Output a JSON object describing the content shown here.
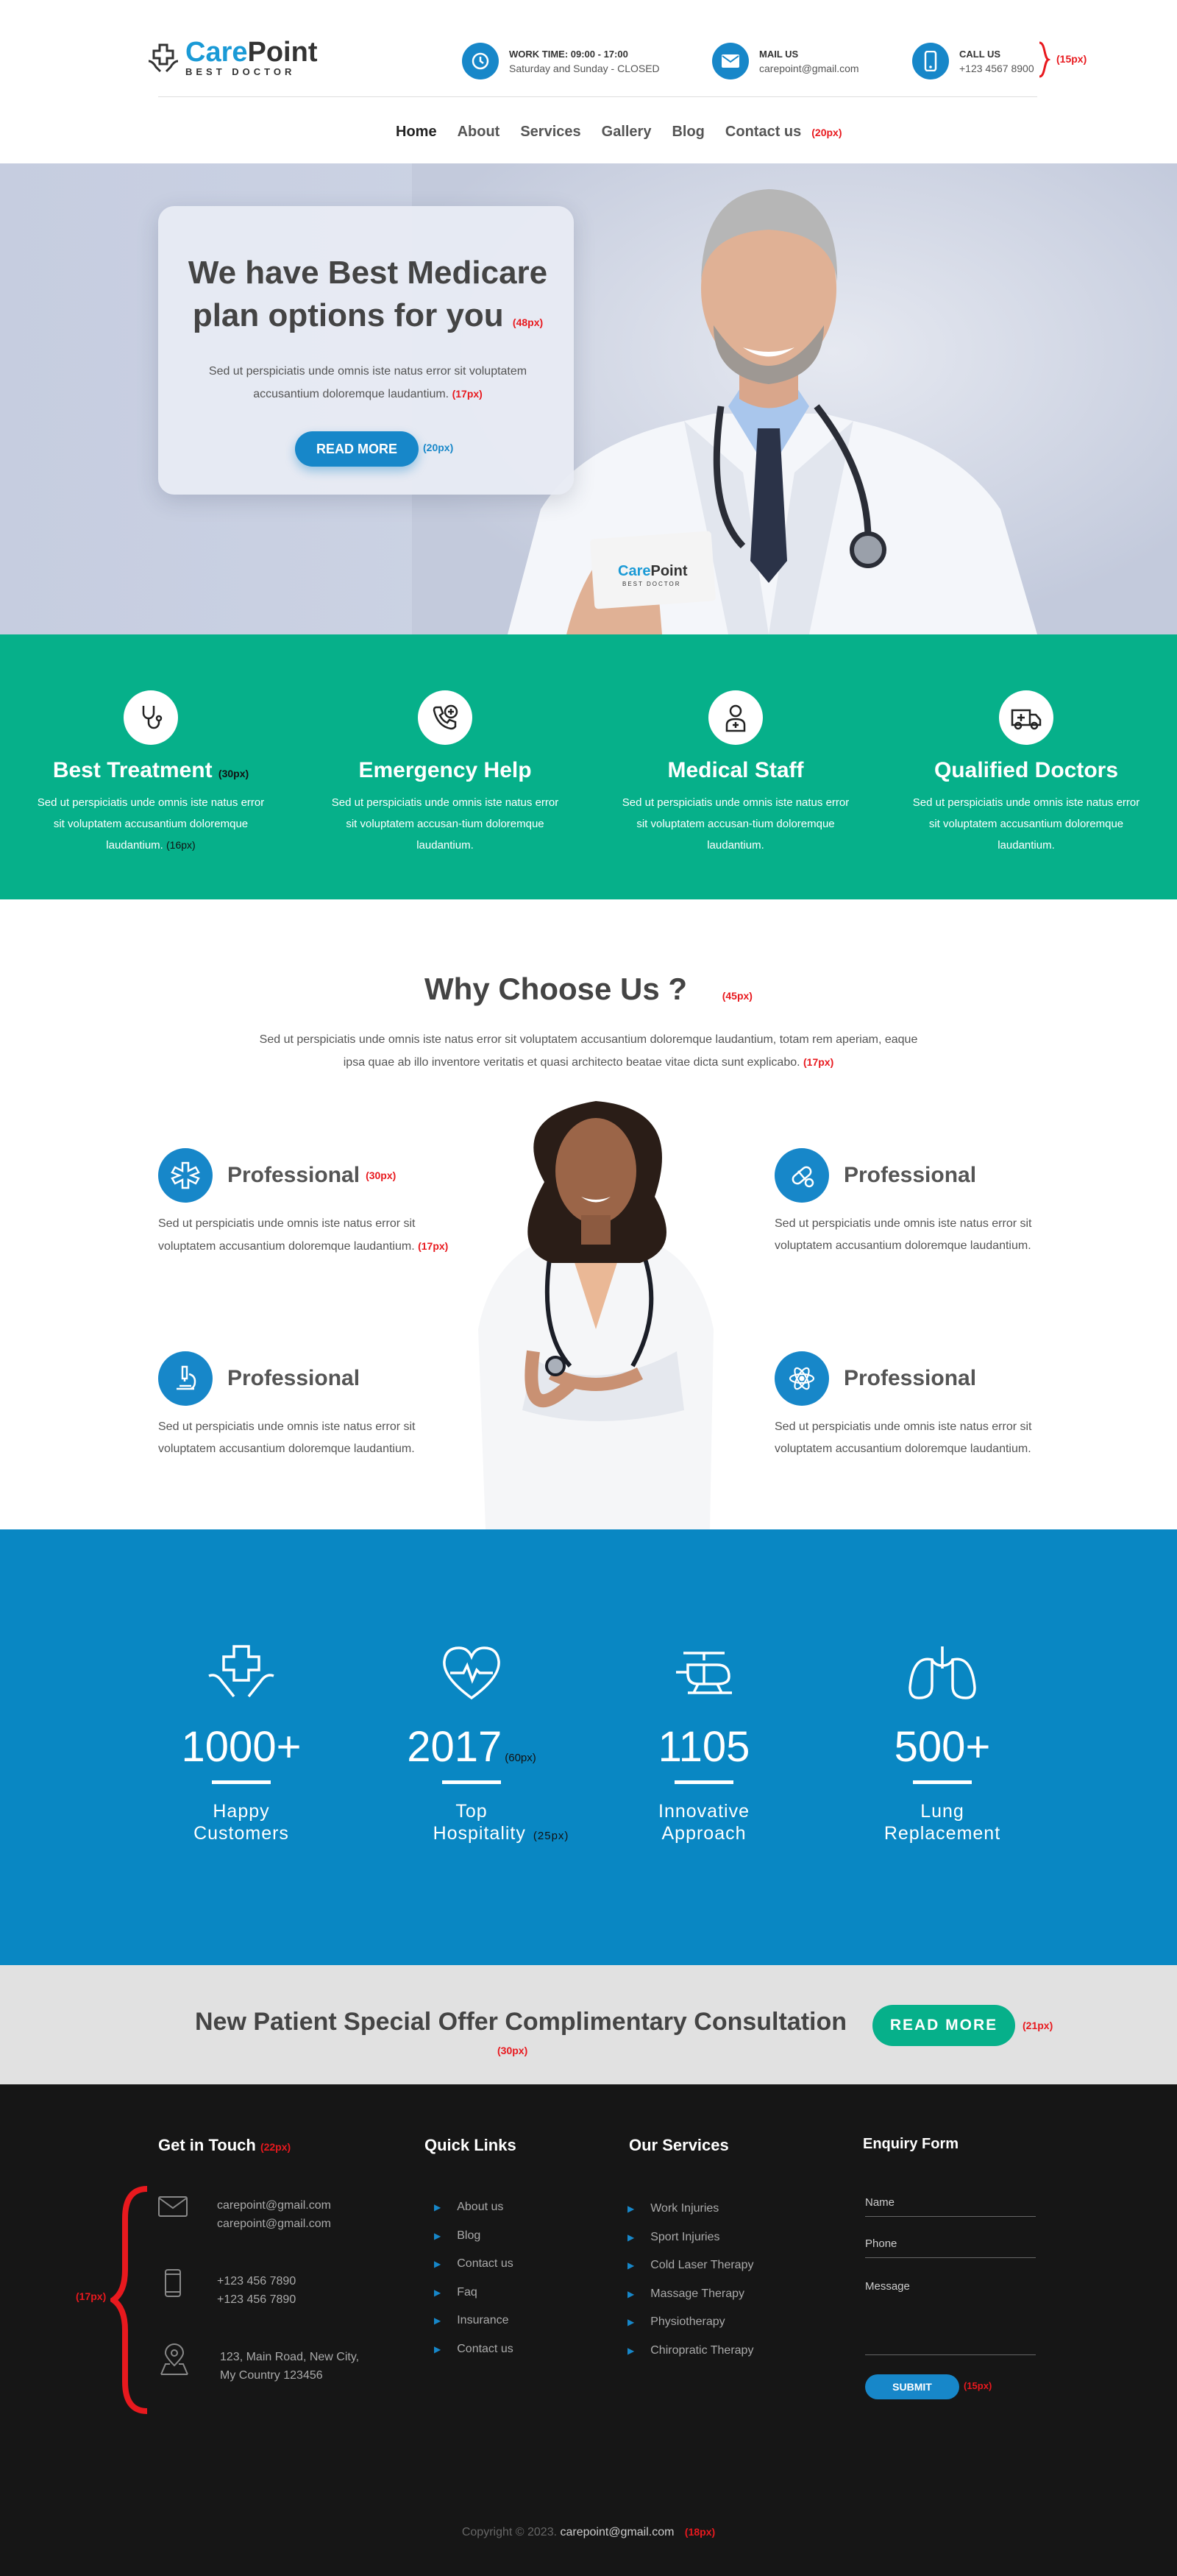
{
  "header": {
    "logo": {
      "name_part1": "Care",
      "name_part2": "Point",
      "tagline": "BEST DOCTOR"
    },
    "work": {
      "title": "WORK TIME: 09:00 - 17:00",
      "sub": "Saturday and Sunday - CLOSED",
      "icon": "clock-icon"
    },
    "mail": {
      "title": "MAIL US",
      "sub": "carepoint@gmail.com",
      "icon": "mail-icon"
    },
    "call": {
      "title": "CALL US",
      "sub": "+123 4567 8900",
      "icon": "phone-icon"
    },
    "size_note": "(15px)"
  },
  "nav": {
    "items": [
      "Home",
      "About",
      "Services",
      "Gallery",
      "Blog",
      "Contact us"
    ],
    "size_note": "(20px)"
  },
  "hero": {
    "title": "We have Best Medicare plan options for you",
    "title_note": "(48px)",
    "text": "Sed ut perspiciatis unde omnis iste natus error sit voluptatem accusantium doloremque laudantium.",
    "text_note": "(17px)",
    "button": "READ MORE",
    "button_note": "(20px)",
    "card_logo_1": "Care",
    "card_logo_2": "Point",
    "card_logo_sub": "BEST DOCTOR"
  },
  "features": {
    "title_note": "(30px)",
    "text_note": "(16px)",
    "items": [
      {
        "title": "Best Treatment",
        "text": "Sed ut perspiciatis unde omnis iste natus error sit voluptatem accusantium doloremque laudantium.",
        "icon": "stethoscope-icon"
      },
      {
        "title": "Emergency Help",
        "text": "Sed ut perspiciatis unde omnis iste natus error sit voluptatem accusan-tium doloremque laudantium.",
        "icon": "phone-medical-icon"
      },
      {
        "title": "Medical Staff",
        "text": "Sed ut perspiciatis unde omnis iste natus error sit voluptatem accusan-tium doloremque laudantium.",
        "icon": "doctor-icon"
      },
      {
        "title": "Qualified Doctors",
        "text": "Sed ut perspiciatis unde omnis iste natus error sit voluptatem accusantium doloremque laudantium.",
        "icon": "ambulance-icon"
      }
    ]
  },
  "why": {
    "title": "Why Choose Us ?",
    "title_note": "(45px)",
    "text": "Sed ut perspiciatis unde omnis iste natus error sit voluptatem accusantium doloremque laudantium, totam rem aperiam, eaque ipsa quae ab illo inventore veritatis et quasi architecto beatae vitae dicta sunt explicabo.",
    "text_note": "(17px)",
    "items": [
      {
        "title": "Professional",
        "text": "Sed ut perspiciatis unde omnis iste natus error sit voluptatem accusantium doloremque laudantium.",
        "icon": "medical-star-icon"
      },
      {
        "title": "Professional",
        "text": "Sed ut perspiciatis unde omnis iste natus error sit voluptatem accusantium doloremque laudantium.",
        "icon": "pill-icon"
      },
      {
        "title": "Professional",
        "text": "Sed ut perspiciatis unde omnis iste natus error sit voluptatem accusantium doloremque laudantium.",
        "icon": "microscope-icon"
      },
      {
        "title": "Professional",
        "text": "Sed ut perspiciatis unde omnis iste natus error sit voluptatem accusantium doloremque laudantium.",
        "icon": "atom-icon"
      }
    ],
    "item_title_note": "(30px)",
    "item_text_note": "(17px)"
  },
  "stats": {
    "num_note": "(60px)",
    "label_note": "(25px)",
    "items": [
      {
        "num": "1000+",
        "label1": "Happy",
        "label2": "Customers",
        "icon": "hands-cross-icon"
      },
      {
        "num": "2017",
        "label1": "Top",
        "label2": "Hospitality",
        "icon": "heartbeat-icon"
      },
      {
        "num": "1105",
        "label1": "Innovative",
        "label2": "Approach",
        "icon": "helicopter-icon"
      },
      {
        "num": "500+",
        "label1": "Lung",
        "label2": "Replacement",
        "icon": "lungs-icon"
      }
    ]
  },
  "offer": {
    "text": "New Patient Special Offer Complimentary Consultation",
    "text_note": "(30px)",
    "button": "READ MORE",
    "button_note": "(21px)"
  },
  "footer": {
    "get_in_touch": "Get in Touch",
    "git_note": "(22px)",
    "contact_note": "(17px)",
    "emails": [
      "carepoint@gmail.com",
      "carepoint@gmail.com"
    ],
    "phones": [
      "+123 456 7890",
      "+123 456 7890"
    ],
    "address": [
      "123, Main Road, New City,",
      "My Country 123456"
    ],
    "quick_links_title": "Quick Links",
    "quick_links": [
      "About us",
      "Blog",
      "Contact us",
      "Faq",
      "Insurance",
      "Contact us"
    ],
    "services_title": "Our Services",
    "services": [
      "Work Injuries",
      "Sport Injuries",
      "Cold Laser Therapy",
      "Massage Therapy",
      "Physiotherapy",
      "Chiropratic Therapy"
    ],
    "enquiry_title": "Enquiry Form",
    "form": {
      "name": "Name",
      "phone": "Phone",
      "message": "Message",
      "submit": "SUBMIT",
      "submit_note": "(15px)"
    },
    "copyright": "Copyright © 2023. ",
    "copyright_mail": "carepoint@gmail.com",
    "copyright_note": "(18px)"
  }
}
